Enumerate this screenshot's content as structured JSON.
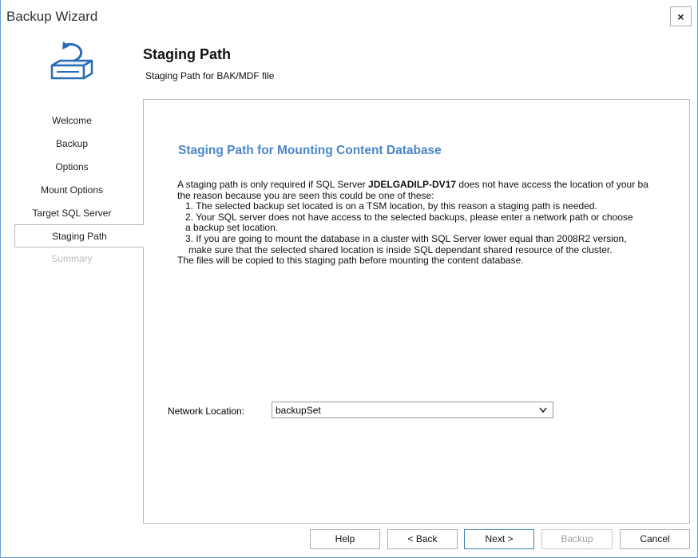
{
  "window": {
    "title": "Backup Wizard",
    "close_glyph": "×"
  },
  "header": {
    "icon": "backup-wizard-icon",
    "title": "Staging Path",
    "subtitle": "Staging Path for BAK/MDF file"
  },
  "nav": {
    "items": [
      {
        "label": "Welcome",
        "state": "normal"
      },
      {
        "label": "Backup",
        "state": "normal"
      },
      {
        "label": "Options",
        "state": "normal"
      },
      {
        "label": "Mount Options",
        "state": "normal"
      },
      {
        "label": "Target SQL Server",
        "state": "normal"
      },
      {
        "label": "Staging Path",
        "state": "active"
      },
      {
        "label": "Summary",
        "state": "disabled"
      }
    ]
  },
  "content": {
    "heading": "Staging Path for Mounting Content Database",
    "line1_pre": "A staging path is only required if SQL Server ",
    "line1_server": "JDELGADILP-DV17",
    "line1_post": " does not have access the location of your ba",
    "line2": "the reason because you are seen this could be one of these:",
    "item1": "1. The selected backup set located is on a TSM location, by this reason a staging path is needed.",
    "item2a": "2. Your SQL server does not have access to the selected backups, please enter a network path or choose",
    "item2b": "a backup set location.",
    "item3a": "3. If you are going to mount the database in a cluster with SQL Server lower equal than 2008R2 version,",
    "item3b": "make sure that the selected shared location is inside SQL dependant shared resource of the cluster.",
    "footer": "The files will be copied to this staging path before mounting the content database.",
    "network_label": "Network Location:",
    "network_value": "backupSet"
  },
  "buttons": {
    "help": "Help",
    "back": "< Back",
    "next": "Next >",
    "backup": "Backup",
    "cancel": "Cancel"
  },
  "colors": {
    "accent": "#4a86c8",
    "window_border": "#6a9fd4",
    "disabled_text": "#bdbdbd"
  }
}
